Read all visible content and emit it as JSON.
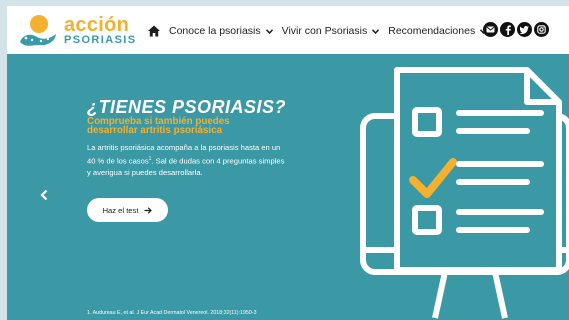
{
  "logo": {
    "line1": "acción",
    "line2": "PSORIASIS"
  },
  "nav": {
    "home_icon": "home-icon",
    "items": [
      {
        "label": "Conoce la psoriasis"
      },
      {
        "label": "Vivir con Psoriasis"
      },
      {
        "label": "Recomendaciones"
      }
    ]
  },
  "socials": [
    "email-icon",
    "facebook-icon",
    "twitter-icon",
    "instagram-icon"
  ],
  "hero": {
    "title": "¿TIENES PSORIASIS?",
    "subtitle": "Comprueba si también puedes desarrollar artritis psoriásica",
    "body_part1": "La artritis psoriásica acompaña a la psoriasis hasta en un 40 % de los casos",
    "body_sup": "1",
    "body_part2": ". Sal de dudas con 4 preguntas simples y averigua si puedes desarrollarla.",
    "cta_label": "Haz el test",
    "footnote": "1. Audureau E, et al. J Eur Acad Dermatol Venereol. 2018;32(11):1950-3"
  },
  "colors": {
    "hero_bg": "#3b98a5",
    "accent_yellow": "#f3b12f",
    "brand_teal": "#3a9aa8"
  }
}
